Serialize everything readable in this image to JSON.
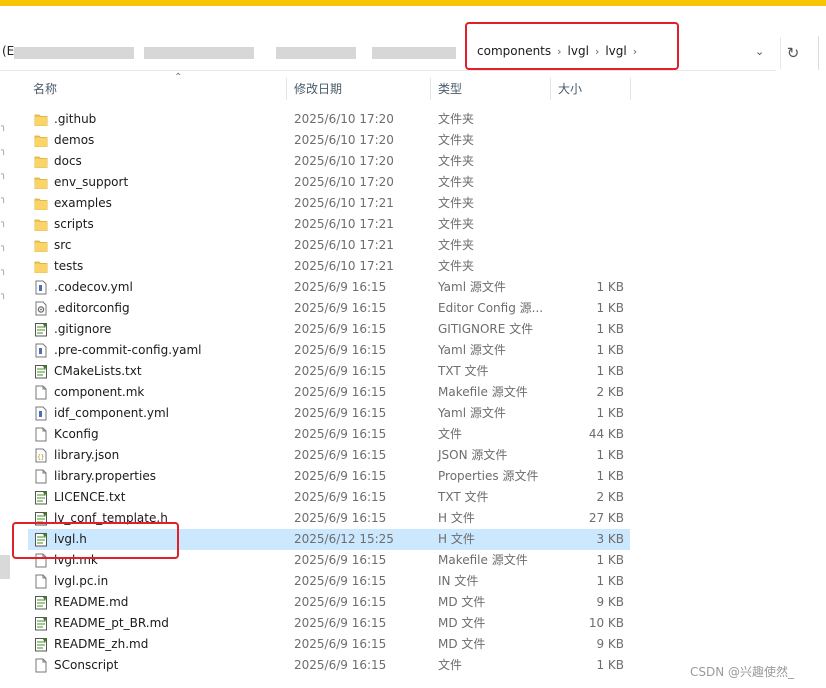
{
  "address_bar": {
    "start_text": "(E",
    "breadcrumbs": [
      "components",
      "lvgl",
      "lvgl"
    ],
    "dropdown_icon": "chevron-down-icon",
    "refresh_icon": "refresh-icon"
  },
  "columns": {
    "name": "名称",
    "date": "修改日期",
    "type": "类型",
    "size": "大小"
  },
  "files": [
    {
      "name": ".github",
      "date": "2025/6/10 17:20",
      "type": "文件夹",
      "size": "",
      "icon": "folder"
    },
    {
      "name": "demos",
      "date": "2025/6/10 17:20",
      "type": "文件夹",
      "size": "",
      "icon": "folder"
    },
    {
      "name": "docs",
      "date": "2025/6/10 17:20",
      "type": "文件夹",
      "size": "",
      "icon": "folder"
    },
    {
      "name": "env_support",
      "date": "2025/6/10 17:20",
      "type": "文件夹",
      "size": "",
      "icon": "folder"
    },
    {
      "name": "examples",
      "date": "2025/6/10 17:21",
      "type": "文件夹",
      "size": "",
      "icon": "folder"
    },
    {
      "name": "scripts",
      "date": "2025/6/10 17:21",
      "type": "文件夹",
      "size": "",
      "icon": "folder"
    },
    {
      "name": "src",
      "date": "2025/6/10 17:21",
      "type": "文件夹",
      "size": "",
      "icon": "folder"
    },
    {
      "name": "tests",
      "date": "2025/6/10 17:21",
      "type": "文件夹",
      "size": "",
      "icon": "folder"
    },
    {
      "name": ".codecov.yml",
      "date": "2025/6/9 16:15",
      "type": "Yaml 源文件",
      "size": "1 KB",
      "icon": "yaml"
    },
    {
      "name": ".editorconfig",
      "date": "2025/6/9 16:15",
      "type": "Editor Config 源...",
      "size": "1 KB",
      "icon": "config"
    },
    {
      "name": ".gitignore",
      "date": "2025/6/9 16:15",
      "type": "GITIGNORE 文件",
      "size": "1 KB",
      "icon": "notepad"
    },
    {
      "name": ".pre-commit-config.yaml",
      "date": "2025/6/9 16:15",
      "type": "Yaml 源文件",
      "size": "1 KB",
      "icon": "yaml"
    },
    {
      "name": "CMakeLists.txt",
      "date": "2025/6/9 16:15",
      "type": "TXT 文件",
      "size": "1 KB",
      "icon": "notepad"
    },
    {
      "name": "component.mk",
      "date": "2025/6/9 16:15",
      "type": "Makefile 源文件",
      "size": "2 KB",
      "icon": "blank"
    },
    {
      "name": "idf_component.yml",
      "date": "2025/6/9 16:15",
      "type": "Yaml 源文件",
      "size": "1 KB",
      "icon": "yaml"
    },
    {
      "name": "Kconfig",
      "date": "2025/6/9 16:15",
      "type": "文件",
      "size": "44 KB",
      "icon": "blank"
    },
    {
      "name": "library.json",
      "date": "2025/6/9 16:15",
      "type": "JSON 源文件",
      "size": "1 KB",
      "icon": "json"
    },
    {
      "name": "library.properties",
      "date": "2025/6/9 16:15",
      "type": "Properties 源文件",
      "size": "1 KB",
      "icon": "blank"
    },
    {
      "name": "LICENCE.txt",
      "date": "2025/6/9 16:15",
      "type": "TXT 文件",
      "size": "2 KB",
      "icon": "notepad"
    },
    {
      "name": "lv_conf_template.h",
      "date": "2025/6/9 16:15",
      "type": "H 文件",
      "size": "27 KB",
      "icon": "notepad"
    },
    {
      "name": "lvgl.h",
      "date": "2025/6/12 15:25",
      "type": "H 文件",
      "size": "3 KB",
      "icon": "notepad",
      "selected": true
    },
    {
      "name": "lvgl.mk",
      "date": "2025/6/9 16:15",
      "type": "Makefile 源文件",
      "size": "1 KB",
      "icon": "blank"
    },
    {
      "name": "lvgl.pc.in",
      "date": "2025/6/9 16:15",
      "type": "IN 文件",
      "size": "1 KB",
      "icon": "blank"
    },
    {
      "name": "README.md",
      "date": "2025/6/9 16:15",
      "type": "MD 文件",
      "size": "9 KB",
      "icon": "notepad"
    },
    {
      "name": "README_pt_BR.md",
      "date": "2025/6/9 16:15",
      "type": "MD 文件",
      "size": "10 KB",
      "icon": "notepad"
    },
    {
      "name": "README_zh.md",
      "date": "2025/6/9 16:15",
      "type": "MD 文件",
      "size": "9 KB",
      "icon": "notepad"
    },
    {
      "name": "SConscript",
      "date": "2025/6/9 16:15",
      "type": "文件",
      "size": "1 KB",
      "icon": "blank"
    }
  ],
  "watermark": "CSDN @兴趣使然_",
  "colors": {
    "accent_bar": "#f7c400",
    "selection": "#cce8ff",
    "annotation_box": "#e0202a",
    "folder": "#f4c752"
  }
}
